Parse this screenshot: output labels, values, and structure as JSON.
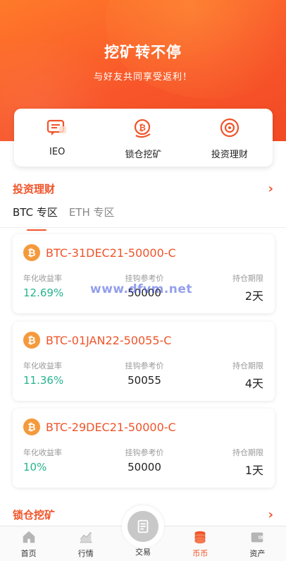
{
  "hero": {
    "title": "挖矿转不停",
    "subtitle": "与好友共同享受返利！"
  },
  "quick_menu": [
    {
      "label": "IEO",
      "icon": "chat-icon"
    },
    {
      "label": "锁仓挖矿",
      "icon": "lock-coin-icon"
    },
    {
      "label": "投资理财",
      "icon": "target-icon"
    }
  ],
  "invest": {
    "title": "投资理财",
    "tabs": [
      "BTC 专区",
      "ETH 专区"
    ],
    "active_tab": 0,
    "cards": [
      {
        "name": "BTC-31DEC21-50000-C",
        "rate_label": "年化收益率",
        "rate": "12.69%",
        "price_label": "挂钩参考价",
        "price": "50000",
        "term_label": "持仓期限",
        "term": "2天"
      },
      {
        "name": "BTC-01JAN22-50055-C",
        "rate_label": "年化收益率",
        "rate": "11.36%",
        "price_label": "挂钩参考价",
        "price": "50055",
        "term_label": "持仓期限",
        "term": "4天"
      },
      {
        "name": "BTC-29DEC21-50000-C",
        "rate_label": "年化收益率",
        "rate": "10%",
        "price_label": "挂钩参考价",
        "price": "50000",
        "term_label": "持仓期限",
        "term": "1天"
      }
    ]
  },
  "mining": {
    "title": "锁仓挖矿"
  },
  "watermark": "www.dfvm.net",
  "tabbar": [
    {
      "label": "首页",
      "icon": "home-icon"
    },
    {
      "label": "行情",
      "icon": "chart-icon"
    },
    {
      "label": "交易",
      "icon": "trade-icon"
    },
    {
      "label": "币币",
      "icon": "coins-icon"
    },
    {
      "label": "资产",
      "icon": "wallet-icon"
    }
  ],
  "colors": {
    "accent": "#f0542a",
    "green": "#27b38f",
    "coin": "#f49a3d"
  }
}
